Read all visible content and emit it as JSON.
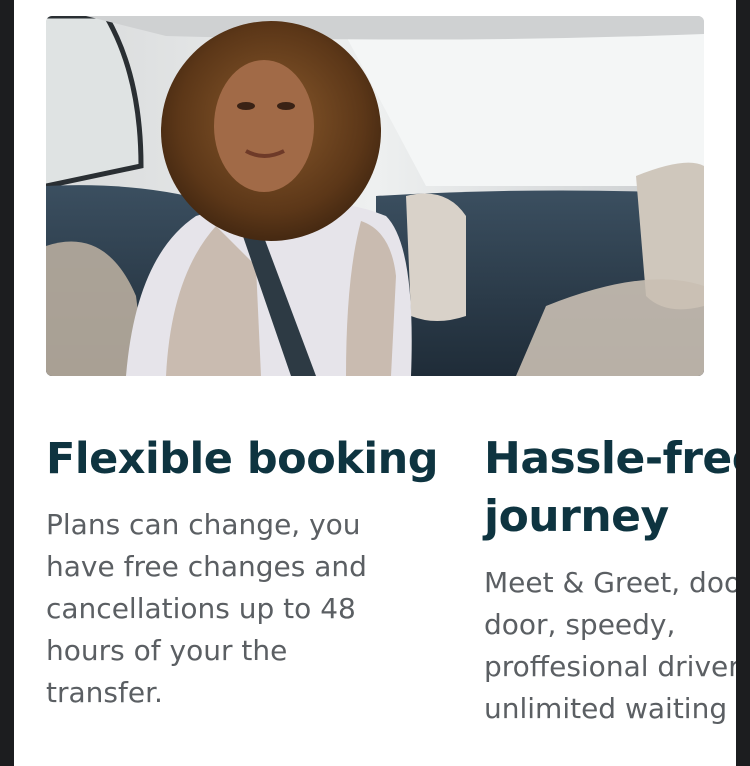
{
  "hero": {
    "image_label": "Woman smiling in back seat of a car"
  },
  "features": [
    {
      "title": "Flexible booking",
      "description": "Plans can change, you have free changes and cancellations up to 48 hours of your the transfer."
    },
    {
      "title_line1": "Hassle-free",
      "title_line2": "journey",
      "desc_line1": "Meet & Greet, door to",
      "desc_line2": "door, speedy,",
      "desc_line3": "proffesional driver,",
      "desc_line4": "unlimited waiting time"
    }
  ],
  "colors": {
    "heading": "#0e3440",
    "body_text": "#5b5f63",
    "background": "#ffffff",
    "frame": "#1c1d1f"
  }
}
